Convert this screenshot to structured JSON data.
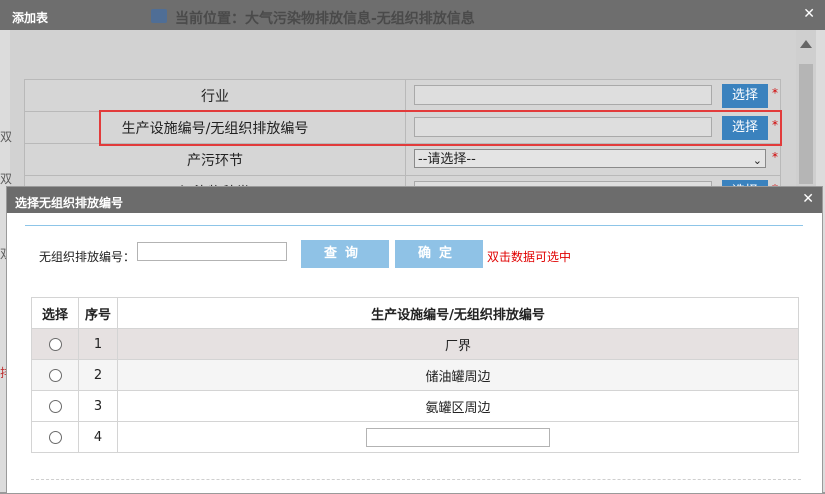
{
  "outer_dialog": {
    "title": "添加表",
    "close": "✕",
    "breadcrumb": "当前位置：大气污染物排放信息-无组织排放信息",
    "fields": [
      {
        "label": "行业",
        "button": "选择",
        "required": "*"
      },
      {
        "label": "生产设施编号/无组织排放编号",
        "button": "选择",
        "required": "*"
      },
      {
        "label": "产污环节",
        "select_value": "--请选择--",
        "required": "*"
      },
      {
        "label": "污染物种类",
        "button": "选择",
        "required": "*"
      }
    ],
    "ghost_chars": [
      "双",
      "双",
      "双",
      "排"
    ]
  },
  "inner_dialog": {
    "title": "选择无组织排放编号",
    "close": "✕",
    "search": {
      "label": "无组织排放编号：",
      "query_button": "查询",
      "confirm_button": "确定",
      "hint": "双击数据可选中"
    },
    "table": {
      "headers": [
        "选择",
        "序号",
        "生产设施编号/无组织排放编号"
      ],
      "rows": [
        {
          "no": "1",
          "name": "厂界"
        },
        {
          "no": "2",
          "name": "储油罐周边"
        },
        {
          "no": "3",
          "name": "氨罐区周边"
        },
        {
          "no": "4",
          "name": ""
        }
      ]
    }
  }
}
